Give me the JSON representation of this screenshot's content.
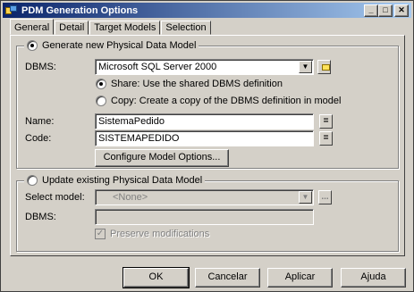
{
  "window": {
    "title": "PDM Generation Options",
    "controls": {
      "minimize": "_",
      "maximize": "□",
      "close": "✕"
    }
  },
  "tabs": [
    {
      "label": "General",
      "active": true
    },
    {
      "label": "Detail",
      "active": false
    },
    {
      "label": "Target Models",
      "active": false
    },
    {
      "label": "Selection",
      "active": false
    }
  ],
  "generate_new": {
    "radio_label": "Generate new Physical Data Model",
    "selected": true,
    "dbms_label": "DBMS:",
    "dbms_value": "Microsoft SQL Server 2000",
    "share_label": "Share: Use the shared DBMS definition",
    "share_selected": true,
    "copy_label": "Copy: Create a copy of the DBMS definition in model",
    "copy_selected": false,
    "name_label": "Name:",
    "name_value": "SistemaPedido",
    "code_label": "Code:",
    "code_value": "SISTEMAPEDIDO",
    "equals_glyph": "=",
    "configure_button": "Configure Model Options..."
  },
  "update_existing": {
    "radio_label": "Update existing Physical Data Model",
    "selected": false,
    "select_model_label": "Select model:",
    "select_model_value": "<None>",
    "dbms_label": "DBMS:",
    "dbms_value": "",
    "ellipsis_glyph": "...",
    "preserve_label": "Preserve modifications",
    "preserve_checked": true
  },
  "footer": {
    "ok": "OK",
    "cancel": "Cancelar",
    "apply": "Aplicar",
    "help": "Ajuda"
  },
  "icons": {
    "dropdown_arrow": "▼",
    "check": "✓"
  },
  "colors": {
    "titlebar_start": "#0a246a",
    "titlebar_end": "#a6caf0",
    "face": "#d4d0c8"
  }
}
